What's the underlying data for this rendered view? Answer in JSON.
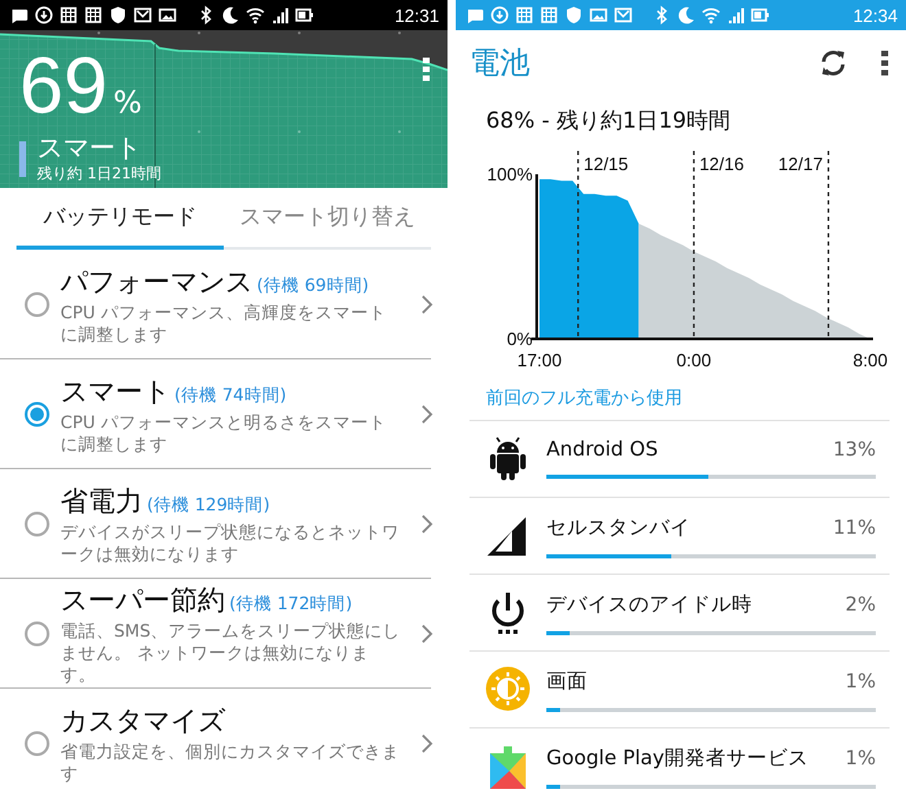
{
  "left_screen": {
    "status_bar": {
      "time": "12:31"
    },
    "header": {
      "percent": "69",
      "percent_sign": "%",
      "mode": "スマート",
      "remaining": "残り約 1日21時間"
    },
    "tabs": [
      {
        "label": "バッテリモード",
        "selected": true
      },
      {
        "label": "スマート切り替え",
        "selected": false
      }
    ],
    "modes": [
      {
        "title": "パフォーマンス",
        "standby": "(待機 69時間)",
        "description": "CPU パフォーマンス、高輝度をスマートに調整します",
        "selected": false
      },
      {
        "title": "スマート",
        "standby": "(待機 74時間)",
        "description": "CPU パフォーマンスと明るさをスマートに調整します",
        "selected": true
      },
      {
        "title": "省電力",
        "standby": "(待機 129時間)",
        "description": "デバイスがスリープ状態になるとネットワークは無効になります",
        "selected": false
      },
      {
        "title": "スーパー節約",
        "standby": "(待機 172時間)",
        "description": "電話、SMS、アラームをスリープ状態にしません。 ネットワークは無効になります。",
        "selected": false
      },
      {
        "title": "カスタマイズ",
        "description": "省電力設定を、個別にカスタマイズできます",
        "selected": false
      }
    ]
  },
  "right_screen": {
    "status_bar": {
      "time": "12:34"
    },
    "title": "電池",
    "summary": "68% - 残り約1日19時間",
    "chart_data": {
      "type": "area",
      "categories": [
        "17:00",
        null,
        null,
        null,
        null,
        null,
        null,
        null,
        null,
        null,
        null,
        null,
        null,
        null,
        "0:00",
        null,
        null,
        null,
        null,
        null,
        null,
        null,
        null,
        null,
        null,
        null,
        null,
        null,
        null,
        null,
        "8:00"
      ],
      "series": [
        {
          "color": "#0aa5e6",
          "values": [
            97,
            97,
            96,
            96,
            88,
            88,
            87,
            87,
            84,
            70,
            null,
            null,
            null,
            null,
            null,
            null,
            null,
            null,
            null,
            null,
            null,
            null,
            null,
            null,
            null,
            null,
            null,
            null,
            null,
            null,
            null
          ]
        },
        {
          "color": "#ccd3d6",
          "values": [
            null,
            null,
            null,
            null,
            null,
            null,
            null,
            null,
            null,
            70,
            67,
            63,
            60,
            57,
            53,
            50,
            47,
            43,
            40,
            37,
            33,
            30,
            27,
            23,
            20,
            17,
            13,
            10,
            7,
            3,
            0
          ]
        }
      ],
      "ylim": [
        0,
        100
      ],
      "yticks": [
        {
          "value": 0,
          "label": "0%"
        },
        {
          "value": 100,
          "label": "100%"
        }
      ],
      "annotations": [
        "12/15",
        "12/16",
        "12/17"
      ]
    },
    "section_label": "前回のフル充電から使用",
    "usage": [
      {
        "name": "Android OS",
        "percent": "13%",
        "level": 0.49
      },
      {
        "name": "セルスタンバイ",
        "percent": "11%",
        "level": 0.38
      },
      {
        "name": "デバイスのアイドル時",
        "percent": "2%",
        "level": 0.07
      },
      {
        "name": "画面",
        "percent": "1%",
        "level": 0.04
      },
      {
        "name": "Google Play開発者サービス",
        "percent": "1%",
        "level": 0.04
      }
    ]
  }
}
